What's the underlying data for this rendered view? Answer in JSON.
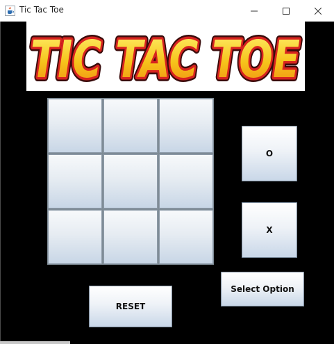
{
  "window": {
    "title": "Tic Tac Toe",
    "icon": "java-cup-icon"
  },
  "banner": {
    "logo_text": "TIC TAC TOE"
  },
  "board": {
    "cells": [
      "",
      "",
      "",
      "",
      "",
      "",
      "",
      "",
      ""
    ]
  },
  "options": {
    "o_label": "O",
    "x_label": "X",
    "select_label": "Select Option"
  },
  "controls": {
    "reset_label": "RESET"
  },
  "colors": {
    "background": "#000000",
    "button_gradient_top": "#ffffff",
    "button_gradient_bottom": "#c9d7e8",
    "logo_fill": "#f6c21a",
    "logo_outline": "#c9221f"
  }
}
